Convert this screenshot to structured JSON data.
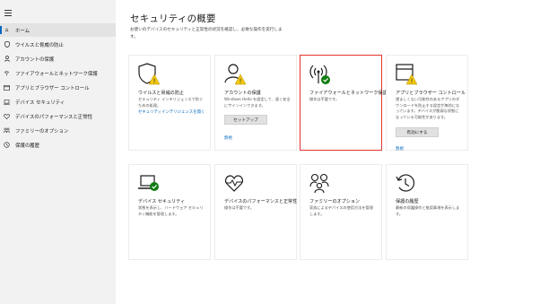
{
  "sidebar": {
    "items": [
      {
        "label": "ホーム",
        "icon": "home-icon"
      },
      {
        "label": "ウイルスと脅威の防止",
        "icon": "shield-icon"
      },
      {
        "label": "アカウントの保護",
        "icon": "person-icon"
      },
      {
        "label": "ファイアウォールとネットワーク保護",
        "icon": "wifi-icon"
      },
      {
        "label": "アプリとブラウザー コントロール",
        "icon": "browser-window-icon"
      },
      {
        "label": "デバイス セキュリティ",
        "icon": "laptop-icon"
      },
      {
        "label": "デバイスのパフォーマンスと正常性",
        "icon": "heart-icon"
      },
      {
        "label": "ファミリーのオプション",
        "icon": "family-icon"
      },
      {
        "label": "保護の履歴",
        "icon": "history-icon"
      }
    ]
  },
  "main": {
    "title": "セキュリティの概要",
    "description": "お使いのデバイスのセキュリティと正常性の状況を確認し、必要な操作を実行します。"
  },
  "cards": [
    {
      "title": "ウイルスと脅威の防止",
      "desc": "セキュリティ インテリジェンスで防ぐための処理。",
      "link": "セキュリティインテリジェンスを開く",
      "icon": "shield-warning-icon"
    },
    {
      "title": "アカウントの保護",
      "desc": "Windows Hello を設定して、速く安全にサインインできます。",
      "button": "セットアップ",
      "link": "無視",
      "icon": "account-warning-icon"
    },
    {
      "title": "ファイアウォールとネットワーク保護",
      "desc": "操作は不要です。",
      "icon": "wifi-check-icon"
    },
    {
      "title": "アプリとブラウザー コントロール",
      "desc": "望ましくない可能性のあるアプリのダウンロードを防止する設定が無効になっています。デバイスが脆弱な状態になっている可能性があります。",
      "button": "有効にする",
      "link": "無視",
      "icon": "browser-warning-icon"
    },
    {
      "title": "デバイス セキュリティ",
      "desc": "状態を表示し、ハードウェア セキュリティ機能を管理します。",
      "icon": "laptop-check-icon"
    },
    {
      "title": "デバイスのパフォーマンスと正常性",
      "desc": "操作は不要です。",
      "icon": "heartbeat-icon"
    },
    {
      "title": "ファミリーのオプション",
      "desc": "家族によるデバイスの使用方法を管理します。",
      "icon": "family-icon"
    },
    {
      "title": "保護の履歴",
      "desc": "最新の保護操作と推奨事項を表示します。",
      "icon": "history-icon"
    }
  ],
  "colors": {
    "accent": "#0067c0",
    "warning": "#f2c811",
    "ok": "#107c10",
    "highlight": "#e3342f"
  }
}
